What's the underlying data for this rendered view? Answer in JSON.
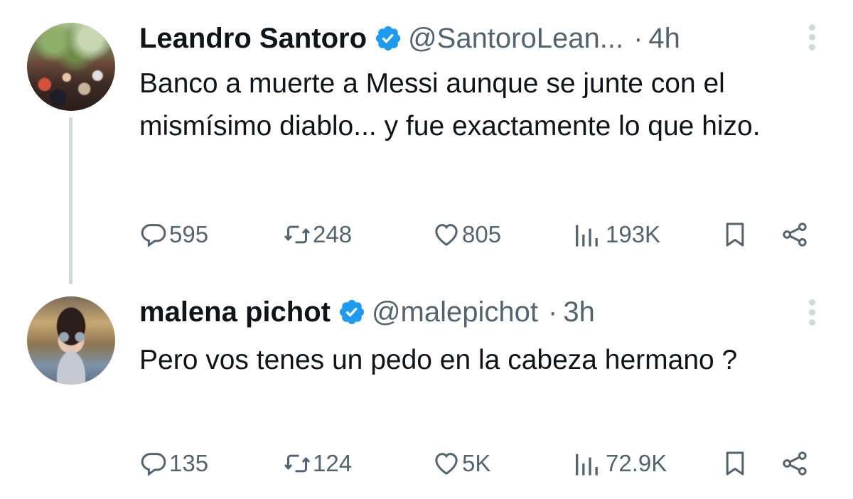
{
  "tweets": [
    {
      "name": "Leandro Santoro",
      "handle": "@SantoroLean...",
      "separator": "·",
      "time": "4h",
      "text": "Banco a muerte a Messi aunque se junte con el mismísimo diablo... y fue exactamente lo que hizo.",
      "replies": "595",
      "reposts": "248",
      "likes": "805",
      "views": "193K"
    },
    {
      "name": "malena pichot",
      "handle": "@malepichot",
      "separator": "·",
      "time": "3h",
      "text": "Pero vos tenes un pedo en la cabeza hermano ?",
      "replies": "135",
      "reposts": "124",
      "likes": "5K",
      "views": "72.9K"
    }
  ],
  "icons": {
    "verified": "verified-badge-icon",
    "reply": "reply-icon",
    "repost": "repost-icon",
    "like": "heart-icon",
    "views": "views-icon",
    "bookmark": "bookmark-icon",
    "share": "share-icon",
    "more": "more-icon"
  },
  "colors": {
    "text": "#0f1419",
    "secondary": "#536471",
    "verified": "#1d9bf0",
    "thread_line": "#cfd9de"
  }
}
